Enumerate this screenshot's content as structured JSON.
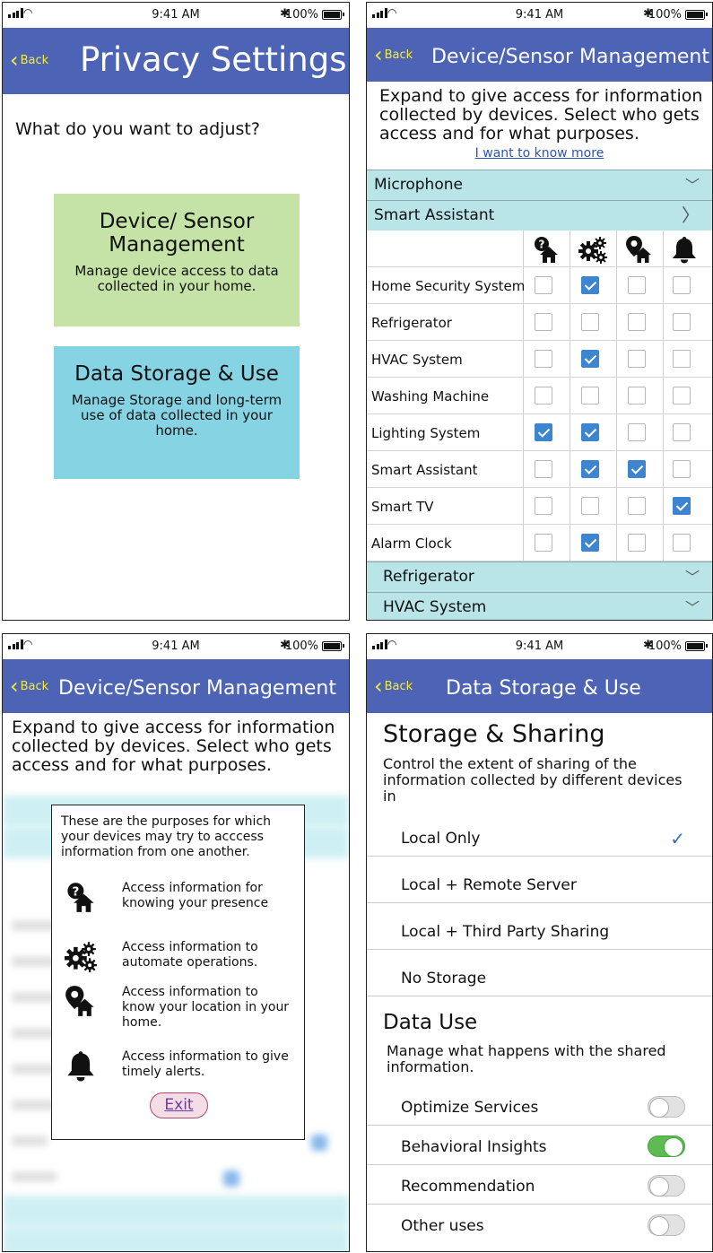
{
  "status": {
    "time": "9:41 AM",
    "bluetooth": "✱",
    "battery": "100%"
  },
  "back_label": "Back",
  "screen1": {
    "title": "Privacy Settings",
    "question": "What do you want to adjust?",
    "tile_device": {
      "title": "Device/ Sensor Management",
      "desc": "Manage device access to data collected in your home.",
      "color": "#c5e3a6"
    },
    "tile_storage": {
      "title": "Data Storage & Use",
      "desc": "Manage Storage and long-term use of data collected in your home.",
      "color": "#85d3e3"
    }
  },
  "screen2": {
    "title": "Device/Sensor Management",
    "intro": "Expand to give access for information collected by devices. Select who gets access and for what purposes.",
    "learn_more": "I want to know more",
    "sections": [
      "Microphone",
      "Smart Assistant",
      "Refrigerator",
      "HVAC System"
    ],
    "header_icons": [
      "presence-icon",
      "automation-icon",
      "location-icon",
      "alert-icon"
    ],
    "devices": [
      {
        "name": "Home Security System",
        "checks": [
          false,
          true,
          false,
          false
        ]
      },
      {
        "name": "Refrigerator",
        "checks": [
          false,
          false,
          false,
          false
        ]
      },
      {
        "name": "HVAC System",
        "checks": [
          false,
          true,
          false,
          false
        ]
      },
      {
        "name": "Washing Machine",
        "checks": [
          false,
          false,
          false,
          false
        ]
      },
      {
        "name": "Lighting System",
        "checks": [
          true,
          true,
          false,
          false
        ]
      },
      {
        "name": "Smart Assistant",
        "checks": [
          false,
          true,
          true,
          false
        ]
      },
      {
        "name": "Smart TV",
        "checks": [
          false,
          false,
          false,
          true
        ]
      },
      {
        "name": "Alarm Clock",
        "checks": [
          false,
          true,
          false,
          false
        ]
      }
    ],
    "check_color": "#3d86cf"
  },
  "screen3": {
    "title": "Device/Sensor Management",
    "intro": "Expand to give access for information collected by devices. Select who gets access and for what purposes.",
    "popup_intro": "These are the purposes for which your devices may try to acccess information from one another.",
    "purposes": [
      {
        "icon": "presence-icon",
        "text": "Access  information for knowing your presence"
      },
      {
        "icon": "automation-icon",
        "text": "Access information to automate operations."
      },
      {
        "icon": "location-icon",
        "text": "Access  information to know your location in your home."
      },
      {
        "icon": "alert-icon",
        "text": "Access  information to give timely alerts."
      }
    ],
    "exit_label": "Exit"
  },
  "screen4": {
    "title": "Data Storage & Use",
    "storage_heading": "Storage & Sharing",
    "storage_desc": "Control the extent of sharing of the information collected by different devices in",
    "options": [
      {
        "label": "Local Only",
        "selected": true
      },
      {
        "label": "Local + Remote Server",
        "selected": false
      },
      {
        "label": "Local + Third Party Sharing",
        "selected": false
      },
      {
        "label": "No Storage",
        "selected": false
      }
    ],
    "use_heading": "Data Use",
    "use_desc": "Manage what happens with the shared information.",
    "toggles": [
      {
        "label": "Optimize Services",
        "on": false
      },
      {
        "label": "Behavioral Insights",
        "on": true
      },
      {
        "label": "Recommendation",
        "on": false
      },
      {
        "label": "Other uses",
        "on": false
      }
    ],
    "accent": "#4d63b5",
    "toggle_on_color": "#5dbb52"
  }
}
